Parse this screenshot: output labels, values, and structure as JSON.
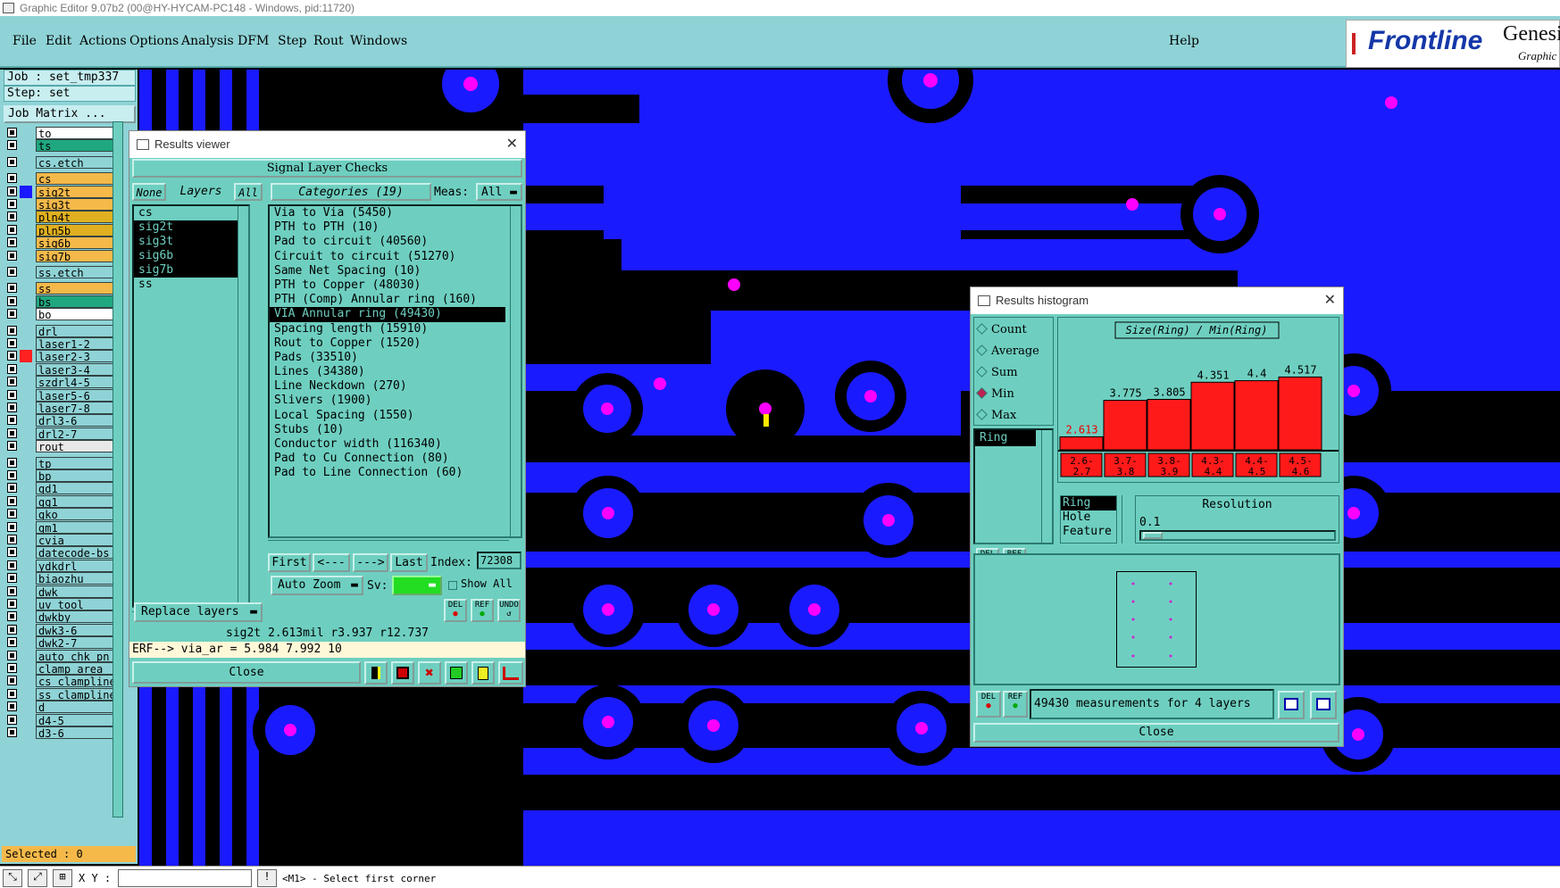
{
  "window_title": "Graphic Editor 9.07b2 (00@HY-HYCAM-PC148 - Windows, pid:11720)",
  "menu": [
    "File",
    "Edit",
    "Actions",
    "Options",
    "Analysis",
    "DFM",
    "Step",
    "Rout",
    "Windows"
  ],
  "help": "Help",
  "logo": {
    "brand": "Frontline",
    "product": "Genesi",
    "sub": "Graphic"
  },
  "job": "Job : set_tmp337",
  "step": "Step: set",
  "job_matrix": "Job Matrix ...",
  "layers": [
    {
      "name": "to",
      "color": "#ffffff"
    },
    {
      "name": "ts",
      "color": "#1fa880"
    },
    {
      "name": "cs.etch",
      "color": "#8fd3d6"
    },
    {
      "name": "cs",
      "color": "#f5b94a"
    },
    {
      "name": "sig2t",
      "color": "#f5b94a",
      "marker": "#1a1aff"
    },
    {
      "name": "sig3t",
      "color": "#f5b94a"
    },
    {
      "name": "pln4t",
      "color": "#e0b020"
    },
    {
      "name": "pln5b",
      "color": "#e0b020"
    },
    {
      "name": "sig6b",
      "color": "#f5b94a"
    },
    {
      "name": "sig7b",
      "color": "#f5b94a"
    },
    {
      "name": "ss.etch",
      "color": "#8fd3d6"
    },
    {
      "name": "ss",
      "color": "#f5b94a"
    },
    {
      "name": "bs",
      "color": "#1fa880"
    },
    {
      "name": "bo",
      "color": "#ffffff"
    },
    {
      "name": "drl",
      "color": "#8fd3d6"
    },
    {
      "name": "laser1-2",
      "color": "#8fd3d6"
    },
    {
      "name": "laser2-3",
      "color": "#8fd3d6",
      "marker": "#ff2020"
    },
    {
      "name": "laser3-4",
      "color": "#8fd3d6"
    },
    {
      "name": "szdrl4-5",
      "color": "#8fd3d6"
    },
    {
      "name": "laser5-6",
      "color": "#8fd3d6"
    },
    {
      "name": "laser7-8",
      "color": "#8fd3d6"
    },
    {
      "name": "drl3-6",
      "color": "#8fd3d6"
    },
    {
      "name": "drl2-7",
      "color": "#8fd3d6"
    },
    {
      "name": "rout",
      "color": "#e8e8e8"
    },
    {
      "name": "tp",
      "color": "#8fd3d6"
    },
    {
      "name": "bp",
      "color": "#8fd3d6"
    },
    {
      "name": "gd1",
      "color": "#8fd3d6"
    },
    {
      "name": "gg1",
      "color": "#8fd3d6"
    },
    {
      "name": "gko",
      "color": "#8fd3d6"
    },
    {
      "name": "gm1",
      "color": "#8fd3d6"
    },
    {
      "name": "cvia",
      "color": "#8fd3d6"
    },
    {
      "name": "datecode-bs",
      "color": "#8fd3d6"
    },
    {
      "name": "ydkdrl",
      "color": "#8fd3d6"
    },
    {
      "name": "biaozhu",
      "color": "#8fd3d6"
    },
    {
      "name": "dwk",
      "color": "#8fd3d6"
    },
    {
      "name": "uv_tool",
      "color": "#8fd3d6"
    },
    {
      "name": "dwkby",
      "color": "#8fd3d6"
    },
    {
      "name": "dwk3-6",
      "color": "#8fd3d6"
    },
    {
      "name": "dwk2-7",
      "color": "#8fd3d6"
    },
    {
      "name": "auto_chk_pn",
      "color": "#8fd3d6"
    },
    {
      "name": "clamp_area",
      "color": "#8fd3d6"
    },
    {
      "name": "cs_clampline",
      "color": "#8fd3d6"
    },
    {
      "name": "ss_clampline",
      "color": "#8fd3d6"
    },
    {
      "name": "d",
      "color": "#8fd3d6"
    },
    {
      "name": "d4-5",
      "color": "#8fd3d6"
    },
    {
      "name": "d3-6",
      "color": "#8fd3d6"
    }
  ],
  "selected": "Selected : 0",
  "status": {
    "xy_label": "X Y :",
    "prompt": "<M1> - Select first corner"
  },
  "results_viewer": {
    "title": "Results viewer",
    "header": "Signal Layer Checks",
    "none_btn": "None",
    "layers_label": "Layers",
    "all_btn": "All",
    "layer_list": [
      {
        "name": "cs",
        "sel": false
      },
      {
        "name": "sig2t",
        "sel": true
      },
      {
        "name": "sig3t",
        "sel": true
      },
      {
        "name": "sig6b",
        "sel": true
      },
      {
        "name": "sig7b",
        "sel": true
      },
      {
        "name": "ss",
        "sel": false
      }
    ],
    "categories_label": "Categories (19)",
    "meas_label": "Meas:",
    "meas_value": "All",
    "categories": [
      {
        "name": "Via to Via (5450)",
        "sel": false
      },
      {
        "name": "PTH to PTH (10)",
        "sel": false
      },
      {
        "name": "Pad to circuit (40560)",
        "sel": false
      },
      {
        "name": "Circuit to circuit (51270)",
        "sel": false
      },
      {
        "name": "Same Net Spacing (10)",
        "sel": false
      },
      {
        "name": "PTH to Copper (48030)",
        "sel": false
      },
      {
        "name": "PTH (Comp) Annular ring (160)",
        "sel": false
      },
      {
        "name": "VIA Annular ring (49430)",
        "sel": true
      },
      {
        "name": "Spacing length (15910)",
        "sel": false
      },
      {
        "name": "Rout to Copper (1520)",
        "sel": false
      },
      {
        "name": "Pads (33510)",
        "sel": false
      },
      {
        "name": "Lines (34380)",
        "sel": false
      },
      {
        "name": "Line Neckdown (270)",
        "sel": false
      },
      {
        "name": "Slivers (1900)",
        "sel": false
      },
      {
        "name": "Local Spacing (1550)",
        "sel": false
      },
      {
        "name": "Stubs (10)",
        "sel": false
      },
      {
        "name": "Conductor width (116340)",
        "sel": false
      },
      {
        "name": "Pad to Cu Connection (80)",
        "sel": false
      },
      {
        "name": "Pad to Line Connection (60)",
        "sel": false
      }
    ],
    "first_btn": "First",
    "prev_btn": "<---",
    "next_btn": "--->",
    "last_btn": "Last",
    "index_label": "Index:",
    "index_value": "72308",
    "auto_zoom": "Auto Zoom",
    "sv_label": "Sv:",
    "show_all": "Show All",
    "replace_layers": "Replace layers",
    "icon_del": "DEL",
    "icon_ref": "REF",
    "icon_undo": "UNDO",
    "info_line": "sig2t 2.613mil  r3.937  r12.737",
    "erf_line": "ERF--> via_ar = 5.984 7.992 10",
    "close": "Close"
  },
  "histogram": {
    "title": "Results histogram",
    "options": [
      {
        "label": "Count",
        "checked": false
      },
      {
        "label": "Average",
        "checked": false
      },
      {
        "label": "Sum",
        "checked": false
      },
      {
        "label": "Min",
        "checked": true
      },
      {
        "label": "Max",
        "checked": false
      }
    ],
    "ring_list": "Ring",
    "chart_title": "Size(Ring) / Min(Ring)",
    "feature_list": [
      "Ring",
      "Hole",
      "Feature"
    ],
    "resolution_label": "Resolution",
    "resolution_value": "0.1",
    "summary": "49430 measurements for 4 layers",
    "close": "Close",
    "icon_del": "DEL",
    "icon_ref": "REF",
    "bar_color": "#ff1a1a"
  },
  "chart_data": {
    "type": "bar",
    "title": "Size(Ring) / Min(Ring)",
    "categories": [
      "2.6-2.7",
      "3.7-3.8",
      "3.8-3.9",
      "4.3-4.4",
      "4.4-4.5",
      "4.5-4.6"
    ],
    "values": [
      2.613,
      3.775,
      3.805,
      4.351,
      4.4,
      4.517
    ],
    "value_labels": [
      "2.613",
      "3.775",
      "3.805",
      "4.351",
      "4.4",
      "4.517"
    ],
    "ylim": [
      0,
      4.7
    ]
  }
}
